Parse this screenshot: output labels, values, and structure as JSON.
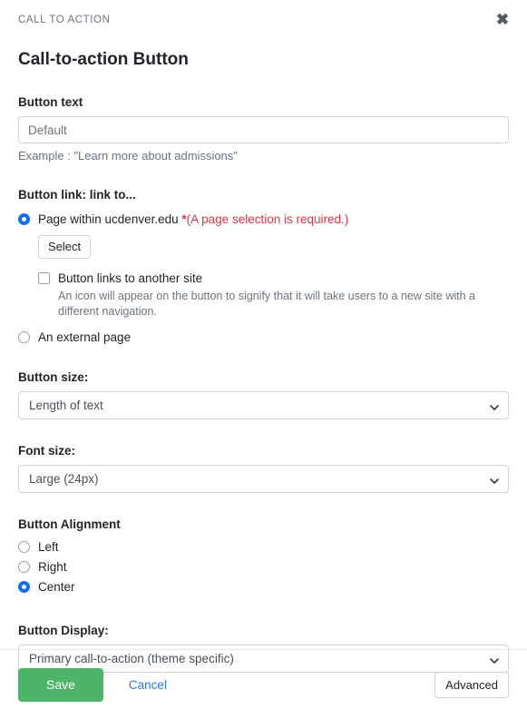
{
  "header": {
    "eyebrow": "CALL TO ACTION",
    "close_icon": "close-icon",
    "close_glyph": "✖"
  },
  "title": "Call-to-action Button",
  "button_text": {
    "label": "Button text",
    "value": "",
    "placeholder": "Default",
    "help": "Example : \"Learn more about admissions\""
  },
  "button_link": {
    "label": "Button link: link to...",
    "options": [
      {
        "label": "Page within ucdenver.edu",
        "selected": true,
        "required_star": "*",
        "required_message": "(A page selection is required.)"
      },
      {
        "label": "An external page",
        "selected": false
      }
    ],
    "select_button": "Select",
    "another_site": {
      "label": "Button links to another site",
      "checked": false,
      "description": "An icon will appear on the button to signify that it will take users to a new site with a different navigation."
    }
  },
  "button_size": {
    "label": "Button size:",
    "value": "Length of text",
    "options": [
      "Length of text"
    ]
  },
  "font_size": {
    "label": "Font size:",
    "value": "Large (24px)",
    "options": [
      "Large (24px)"
    ]
  },
  "alignment": {
    "label": "Button Alignment",
    "options": [
      {
        "label": "Left",
        "selected": false
      },
      {
        "label": "Right",
        "selected": false
      },
      {
        "label": "Center",
        "selected": true
      }
    ]
  },
  "button_display": {
    "label": "Button Display:",
    "value": "Primary call-to-action (theme specific)",
    "options": [
      "Primary call-to-action (theme specific)"
    ]
  },
  "footer": {
    "save": "Save",
    "cancel": "Cancel",
    "advanced": "Advanced"
  },
  "colors": {
    "save_green": "#4cb567",
    "link_blue": "#2a7ae2",
    "radio_blue": "#0d6efd",
    "error_red": "#dc3545",
    "border_gray": "#ced4da"
  }
}
